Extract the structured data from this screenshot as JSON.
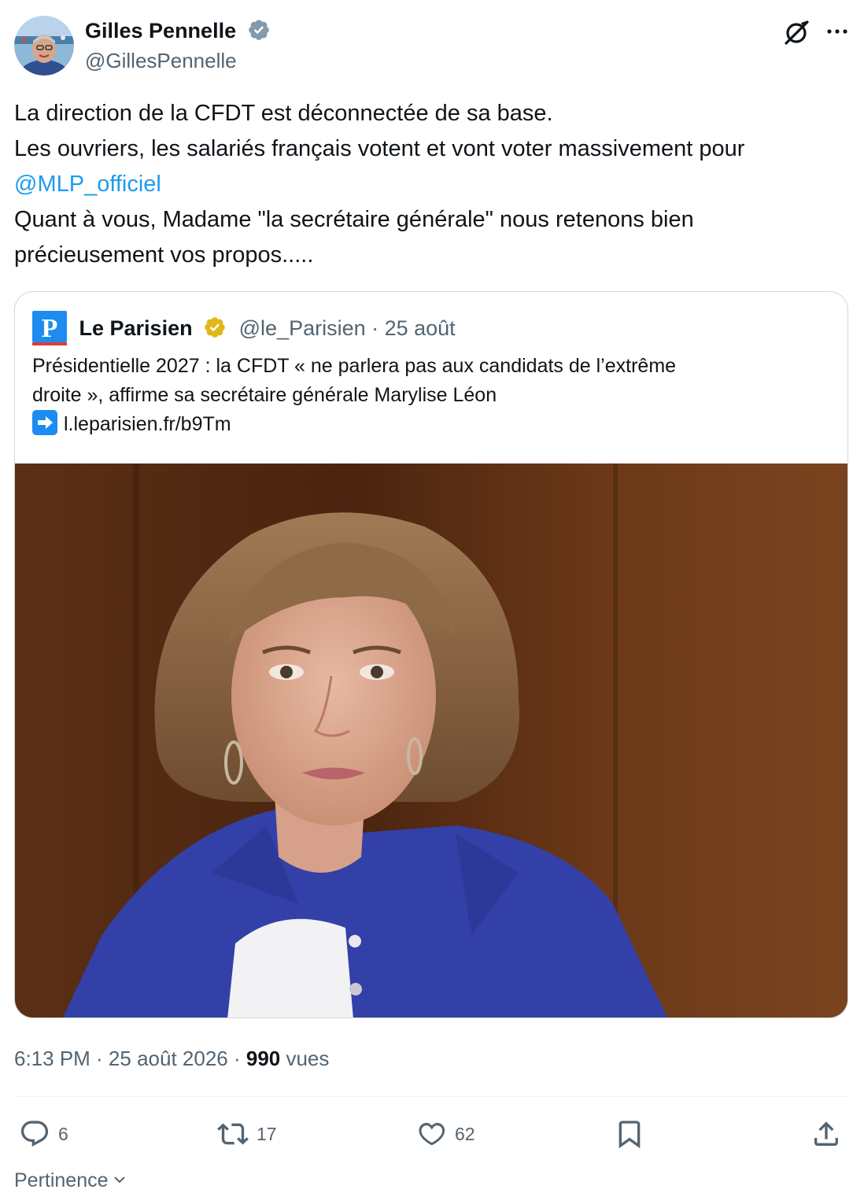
{
  "author": {
    "name": "Gilles Pennelle",
    "handle": "@GillesPennelle",
    "avatar_icon": "profile-photo"
  },
  "tweet": {
    "line1": "La direction de la CFDT est déconnectée de sa base.",
    "line2": "Les ouvriers, les salariés français votent et vont voter massivement pour",
    "mention": "@MLP_officiel",
    "line4": "Quant à vous, Madame \"la secrétaire générale\" nous retenons bien",
    "line5": "précieusement vos propos....."
  },
  "quote": {
    "name": "Le Parisien",
    "logo_letter": "P",
    "handle_date": "@le_Parisien · 25 août",
    "text_line1": "Présidentielle 2027 : la CFDT « ne parlera pas aux candidats de l’extrême",
    "text_line2": "droite », affirme sa secrétaire générale Marylise Léon",
    "link": "l.leparisien.fr/b9Tm",
    "photo_icon": "portrait-photo"
  },
  "meta": {
    "time_date": "6:13 PM · 25 août 2026 · ",
    "views_count": "990",
    "views_label": " vues"
  },
  "actions": {
    "replies": "6",
    "reposts": "17",
    "likes": "62"
  },
  "sort": {
    "label": "Pertinence"
  },
  "colors": {
    "link": "#1d9bf0",
    "secondary_text": "#536471",
    "verified_blue": "#829aab",
    "verified_gold": "#e2b719",
    "brand_parisien": "#1d8cf0"
  }
}
